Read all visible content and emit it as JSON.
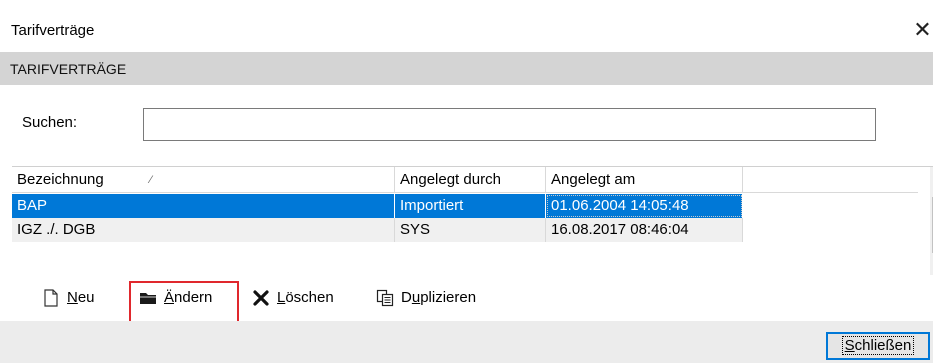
{
  "window": {
    "title": "Tarifverträge",
    "close_glyph": "✕"
  },
  "section": {
    "header": "TARIFVERTRÄGE"
  },
  "search": {
    "label": "Suchen:",
    "value": ""
  },
  "table": {
    "columns": [
      "Bezeichnung",
      "Angelegt durch",
      "Angelegt am"
    ],
    "sort_glyph": "⁄",
    "rows": [
      {
        "bezeichnung": "BAP",
        "angelegt_durch": "Importiert",
        "angelegt_am": "01.06.2004 14:05:48",
        "selected": true
      },
      {
        "bezeichnung": "IGZ ./. DGB",
        "angelegt_durch": "SYS",
        "angelegt_am": "16.08.2017 08:46:04",
        "selected": false
      }
    ]
  },
  "toolbar": {
    "new": {
      "mnemonic": "N",
      "rest": "eu",
      "icon": "new-document-icon"
    },
    "edit": {
      "mnemonic": "Ä",
      "rest": "ndern",
      "icon": "folder-icon"
    },
    "delete": {
      "mnemonic": "L",
      "rest": "öschen",
      "icon": "delete-x-icon"
    },
    "duplicate": {
      "prefix": "D",
      "mnemonic": "u",
      "rest": "plizieren",
      "icon": "duplicate-icon"
    }
  },
  "footer": {
    "close_mnemonic": "S",
    "close_rest": "chließen"
  },
  "colors": {
    "selection": "#0078d7",
    "highlight_border": "#e0282d",
    "section_bg": "#d4d4d4"
  }
}
